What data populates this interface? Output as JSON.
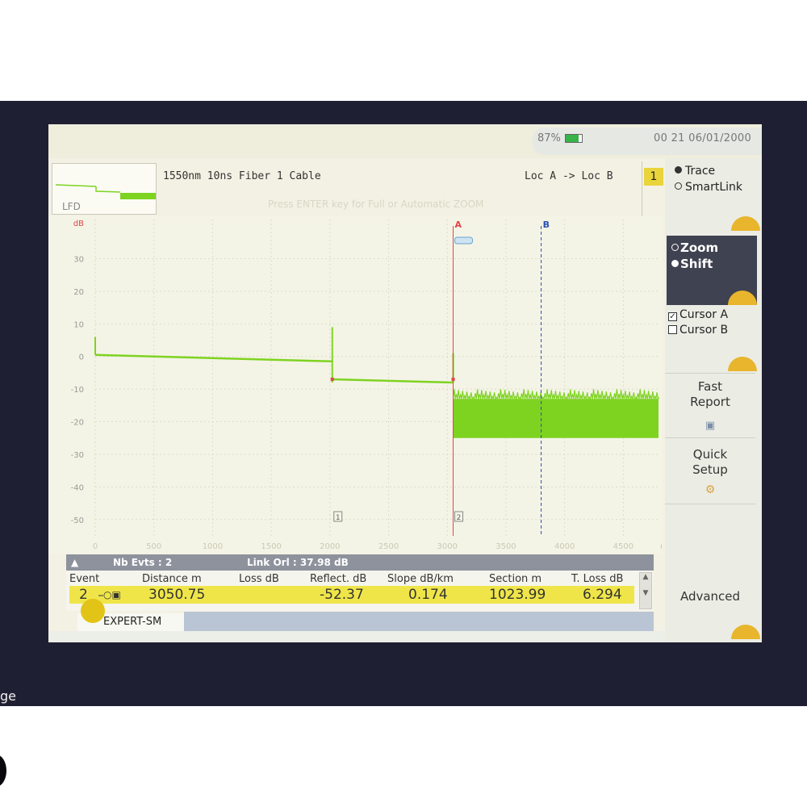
{
  "bezel": {
    "side_label": "ge"
  },
  "status": {
    "battery": "87%",
    "clock": "00 21  06/01/2000"
  },
  "header": {
    "thumb_label": "LFD",
    "acq_params": "1550nm 10ns Fiber 1 Cable",
    "loc": "Loc A -> Loc B",
    "hint": "Press ENTER key for Full or Automatic ZOOM",
    "page_num": "1"
  },
  "right_panel": {
    "trace_label": "Trace",
    "smartlink_label": "SmartLink",
    "zoom_label": "Zoom",
    "shift_label": "Shift",
    "cursor_a_label": "Cursor A",
    "cursor_b_label": "Cursor B",
    "fast_report_label": "Fast\nReport",
    "quick_setup_label": "Quick\nSetup",
    "advanced_label": "Advanced"
  },
  "chart_data": {
    "type": "line",
    "ylabel": "dB",
    "xunit": "m",
    "y_ticks": [
      30,
      20,
      10,
      0,
      -10,
      -20,
      -30,
      -40,
      -50
    ],
    "x_ticks": [
      0,
      500,
      1000,
      1500,
      2000,
      2500,
      3000,
      3500,
      4000,
      4500
    ],
    "xlim": [
      0,
      4800
    ],
    "ylim": [
      -55,
      42
    ],
    "trace_color": "#7ed321",
    "segments": [
      {
        "x": [
          0,
          2020
        ],
        "y": [
          0.5,
          -1.5
        ]
      },
      {
        "x": [
          2020,
          3050
        ],
        "y": [
          -7,
          -8
        ]
      }
    ],
    "events": [
      {
        "label": "1",
        "x": 2020,
        "spike_to": 9
      },
      {
        "label": "2",
        "x": 3050,
        "spike_to": 1
      }
    ],
    "noise": {
      "x": [
        3050,
        4800
      ],
      "y_top": -13,
      "y_bottom": -25
    },
    "cursors": [
      {
        "label": "A",
        "x": 3050,
        "color": "#e0454a"
      },
      {
        "label": "B",
        "x": 3800,
        "color": "#2a4fb0"
      }
    ]
  },
  "events_table": {
    "nb_evts": "Nb Evts : 2",
    "link_orl": "Link Orl : 37.98 dB",
    "headers": [
      "Event",
      "Distance  m",
      "Loss dB",
      "Reflect. dB",
      "Slope  dB/km",
      "Section m",
      "T. Loss dB"
    ],
    "row": {
      "event": "2",
      "distance": "3050.75",
      "loss": "",
      "reflect": "-52.37",
      "slope": "0.174",
      "section": "1023.99",
      "t_loss": "6.294"
    },
    "mode": "EXPERT-SM"
  }
}
